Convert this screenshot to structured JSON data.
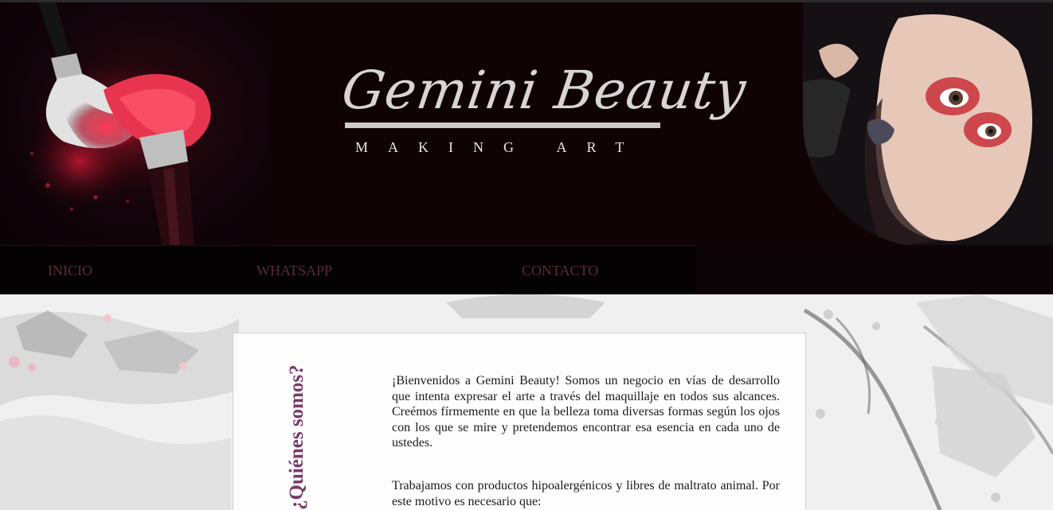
{
  "header": {
    "logo_title": "Gemini Beauty",
    "logo_tagline": "MAKING ART"
  },
  "nav": {
    "items": [
      {
        "label": "INICIO"
      },
      {
        "label": "WHATSAPP"
      },
      {
        "label": "CONTACTO"
      }
    ]
  },
  "about": {
    "heading": "¿Quiénes somos?",
    "paragraph_1": "¡Bienvenidos a Gemini Beauty! Somos un negocio en vías de desarrollo que intenta expresar el arte a través del maquillaje en todos sus alcances. Creémos fírmemente en que la belleza toma diversas formas según los ojos con los que se mire y pretendemos encontrar esa esencia en cada uno de ustedes.",
    "paragraph_2": "Trabajamos con productos hipoalergénicos y libres de maltrato animal. Por este motivo es necesario que:"
  },
  "colors": {
    "header_bg": "#0f0306",
    "nav_bg": "#040203",
    "nav_text": "#5a2a3a",
    "heading_accent": "#7a3a6a",
    "logo_text": "#d9d4d6"
  }
}
